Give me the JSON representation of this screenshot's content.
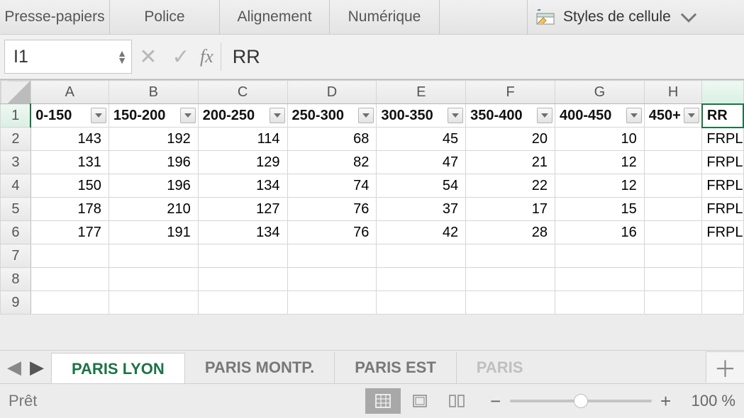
{
  "ribbon": {
    "groups": [
      "Presse-papiers",
      "Police",
      "Alignement",
      "Numérique"
    ],
    "cellStyles": "Styles de cellule"
  },
  "formulaBar": {
    "cellRef": "I1",
    "fxLabel": "fx",
    "value": "RR"
  },
  "columns": [
    "A",
    "B",
    "C",
    "D",
    "E",
    "F",
    "G",
    "H"
  ],
  "headers": {
    "A": "0-150",
    "B": "150-200",
    "C": "200-250",
    "D": "250-300",
    "E": "300-350",
    "F": "350-400",
    "G": "400-450",
    "H": "450+"
  },
  "activeCellValue": "RR",
  "rows": [
    {
      "n": 2,
      "A": "143",
      "B": "192",
      "C": "114",
      "D": "68",
      "E": "45",
      "F": "20",
      "G": "10",
      "H": "",
      "I": "FRPL"
    },
    {
      "n": 3,
      "A": "131",
      "B": "196",
      "C": "129",
      "D": "82",
      "E": "47",
      "F": "21",
      "G": "12",
      "H": "",
      "I": "FRPL"
    },
    {
      "n": 4,
      "A": "150",
      "B": "196",
      "C": "134",
      "D": "74",
      "E": "54",
      "F": "22",
      "G": "12",
      "H": "",
      "I": "FRPL"
    },
    {
      "n": 5,
      "A": "178",
      "B": "210",
      "C": "127",
      "D": "76",
      "E": "37",
      "F": "17",
      "G": "15",
      "H": "",
      "I": "FRPL"
    },
    {
      "n": 6,
      "A": "177",
      "B": "191",
      "C": "134",
      "D": "76",
      "E": "42",
      "F": "28",
      "G": "16",
      "H": "",
      "I": "FRPL"
    },
    {
      "n": 7,
      "A": "",
      "B": "",
      "C": "",
      "D": "",
      "E": "",
      "F": "",
      "G": "",
      "H": "",
      "I": ""
    },
    {
      "n": 8,
      "A": "",
      "B": "",
      "C": "",
      "D": "",
      "E": "",
      "F": "",
      "G": "",
      "H": "",
      "I": ""
    },
    {
      "n": 9,
      "A": "",
      "B": "",
      "C": "",
      "D": "",
      "E": "",
      "F": "",
      "G": "",
      "H": "",
      "I": ""
    }
  ],
  "tabs": {
    "items": [
      "PARIS LYON",
      "PARIS MONTP.",
      "PARIS EST",
      "PARIS"
    ],
    "activeIndex": 0
  },
  "statusBar": {
    "status": "Prêt",
    "zoom": "100 %"
  }
}
